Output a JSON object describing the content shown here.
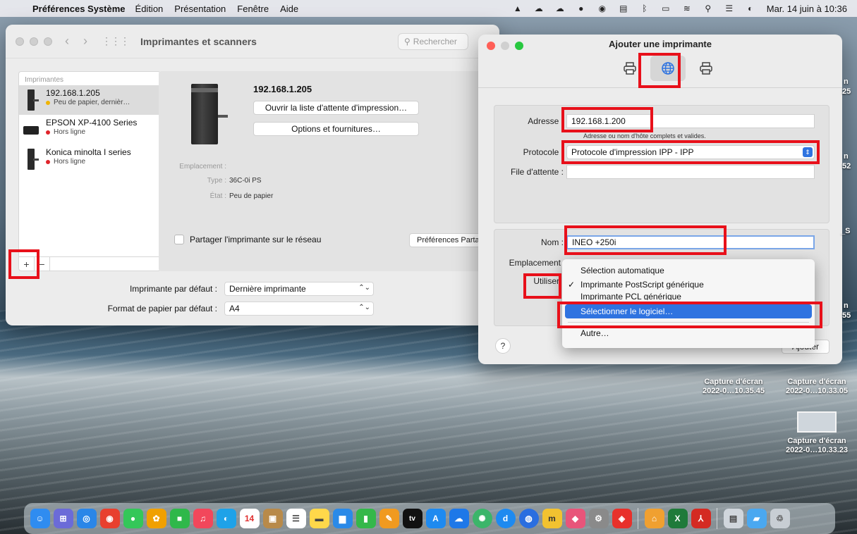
{
  "menubar": {
    "app_name": "Préférences Système",
    "items": [
      "Édition",
      "Présentation",
      "Fenêtre",
      "Aide"
    ],
    "clock": "Mar. 14 juin à 10:36"
  },
  "main_window": {
    "title": "Imprimantes et scanners",
    "search_placeholder": "Rechercher",
    "sidebar_header": "Imprimantes",
    "printers": [
      {
        "name": "192.168.1.205",
        "status": "Peu de papier, dernièr…",
        "status_color": "#f0b400"
      },
      {
        "name": "EPSON XP-4100 Series",
        "status": "Hors ligne",
        "status_color": "#e0242a"
      },
      {
        "name": "Konica minolta I series",
        "status": "Hors ligne",
        "status_color": "#e0242a"
      }
    ],
    "add_button": "+",
    "remove_button": "−",
    "detail": {
      "title": "192.168.1.205",
      "open_queue_button": "Ouvrir la liste d'attente d'impression…",
      "options_button": "Options et fournitures…",
      "location_label": "Emplacement :",
      "type_label": "Type :",
      "type_value": "36C-0i PS",
      "state_label": "État :",
      "state_value": "Peu de papier",
      "share_label": "Partager l'imprimante sur le réseau",
      "share_prefs_button": "Préférences Partage…"
    },
    "default_printer_label": "Imprimante par défaut :",
    "default_printer_value": "Dernière imprimante",
    "default_paper_label": "Format de papier par défaut :",
    "default_paper_value": "A4"
  },
  "dialog": {
    "title": "Ajouter une imprimante",
    "address_label": "Adresse :",
    "address_value": "192.168.1.200",
    "address_hint": "Adresse ou nom d'hôte complets et valides.",
    "protocol_label": "Protocole :",
    "protocol_value": "Protocole d'impression IPP - IPP",
    "queue_label": "File d'attente :",
    "queue_value": "",
    "name_label": "Nom :",
    "name_value": "INEO +250i",
    "location_label": "Emplacement",
    "use_label": "Utiliser",
    "help_button": "?",
    "add_button": "Ajouter"
  },
  "dropdown": {
    "items": [
      "Sélection automatique",
      "Imprimante PostScript générique",
      "Imprimante PCL générique",
      "Sélectionner le logiciel…",
      "Autre…"
    ],
    "checked_index": 1,
    "highlighted_index": 3
  },
  "desktop": {
    "capture1_label": "Capture d'écran",
    "capture1_date": "2022-0…10.35.45",
    "capture2_label": "Capture d'écran",
    "capture2_date": "2022-0…10.33.05",
    "capture3_label": "Capture d'écran",
    "capture3_date": "2022-0…10.33.23",
    "partial_labels": [
      "n",
      "25",
      "n",
      "52",
      "_S",
      "n",
      "55"
    ]
  },
  "dock": {
    "calendar_day": "14",
    "tv_label": "tv"
  },
  "colors": {
    "accent": "#2f73e0",
    "annotation_red": "#e8101a",
    "warning_dot": "#f0b400",
    "offline_dot": "#e0242a"
  }
}
